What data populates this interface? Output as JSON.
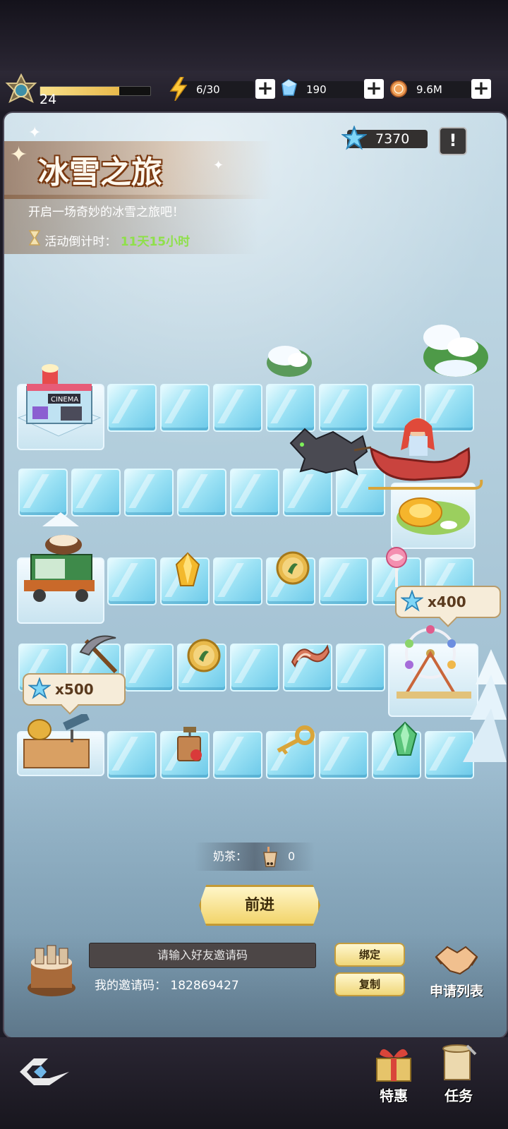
{
  "header": {
    "level": "24",
    "xp_progress": 0.72,
    "energy": "6/30",
    "diamonds": "190",
    "coins": "9.6M"
  },
  "event": {
    "title": "冰雪之旅",
    "subtitle": "开启一场奇妙的冰雪之旅吧！",
    "timer_label": "活动倒计时：",
    "timer_value": "11天15小时",
    "star_score": "7370",
    "info_icon": "exclamation-icon"
  },
  "board": {
    "buildings": [
      "cinema",
      "coffee-truck",
      "observatory",
      "ferris-wheel",
      "gold-fountain"
    ],
    "rewards": [
      {
        "icon": "star-icon",
        "amount": "x400"
      },
      {
        "icon": "star-icon",
        "amount": "x500"
      }
    ],
    "items": [
      "gold-crystal",
      "coin",
      "lollipop",
      "pickaxe",
      "coin",
      "bacon",
      "dynamite",
      "key",
      "green-crystal"
    ]
  },
  "controls": {
    "milk_tea_label": "奶茶：",
    "milk_tea_count": "0",
    "advance_label": "前进"
  },
  "invite": {
    "input_placeholder": "请输入好友邀请码",
    "my_code_label": "我的邀请码：",
    "my_code": "182869427",
    "bind_label": "绑定",
    "copy_label": "复制",
    "request_list_label": "申请列表"
  },
  "bottom_nav": {
    "special_label": "特惠",
    "tasks_label": "任务"
  },
  "colors": {
    "countdown": "#8fe04a",
    "title_outline": "#7a3a12",
    "ice": "#9ee3f5",
    "button_gold": "#f2d46a"
  }
}
